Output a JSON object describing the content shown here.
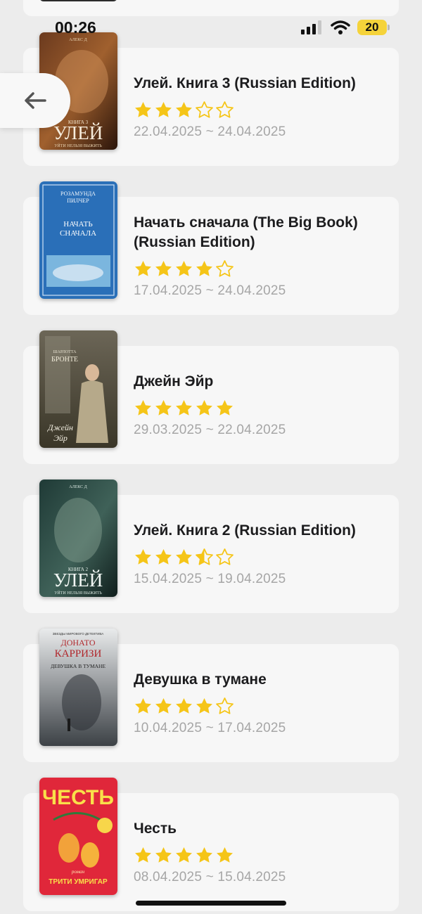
{
  "status_bar": {
    "time": "00:26",
    "battery": "20"
  },
  "colors": {
    "star": "#f5c518",
    "background": "#ececec",
    "card": "#f7f7f7",
    "date": "#a6a6a6"
  },
  "back_button": {
    "icon": "arrow-left-icon"
  },
  "books": [
    {
      "title": "Улей. Книга 3 (Russian Edition)",
      "rating": 3,
      "dates": "22.04.2025 ~ 24.04.2025",
      "cover": {
        "line1": "АЛЕКС Д",
        "line2": "КНИГА 3",
        "line3": "УЛЕЙ",
        "line4": "УЙТИ НЕЛЬЗЯ ВЫЖИТЬ"
      }
    },
    {
      "title": "Начать сначала (The Big Book) (Russian Edition)",
      "rating": 4,
      "dates": "17.04.2025 ~ 24.04.2025",
      "cover": {
        "line1": "РОЗАМУНДА",
        "line2": "ПИЛЧЕР",
        "line3": "НАЧАТЬ",
        "line4": "СНАЧАЛА"
      }
    },
    {
      "title": "Джейн Эйр",
      "rating": 5,
      "dates": "29.03.2025 ~ 22.04.2025",
      "cover": {
        "line1": "ШАРЛОТТА",
        "line2": "БРОНТЕ",
        "line3": "Джейн",
        "line4": "Эйр"
      }
    },
    {
      "title": "Улей. Книга 2 (Russian Edition)",
      "rating": 3.5,
      "dates": "15.04.2025 ~ 19.04.2025",
      "cover": {
        "line1": "АЛЕКС Д",
        "line2": "КНИГА 2",
        "line3": "УЛЕЙ",
        "line4": "УЙТИ НЕЛЬЗЯ ВЫЖИТЬ"
      }
    },
    {
      "title": "Девушка в тумане",
      "rating": 4,
      "dates": "10.04.2025 ~ 17.04.2025",
      "cover": {
        "line1": "ЗВЕЗДЫ МИРОВОГО ДЕТЕКТИВА",
        "line2": "ДОНАТО",
        "line3": "КАРРИЗИ",
        "line4": "ДЕВУШКА В ТУМАНЕ"
      }
    },
    {
      "title": "Честь",
      "rating": 5,
      "dates": "08.04.2025 ~ 15.04.2025",
      "cover": {
        "line1": "ЧЕСТЬ",
        "line2": "роман",
        "line3": "ТРИТИ УМРИГАР",
        "line4": ""
      }
    }
  ]
}
